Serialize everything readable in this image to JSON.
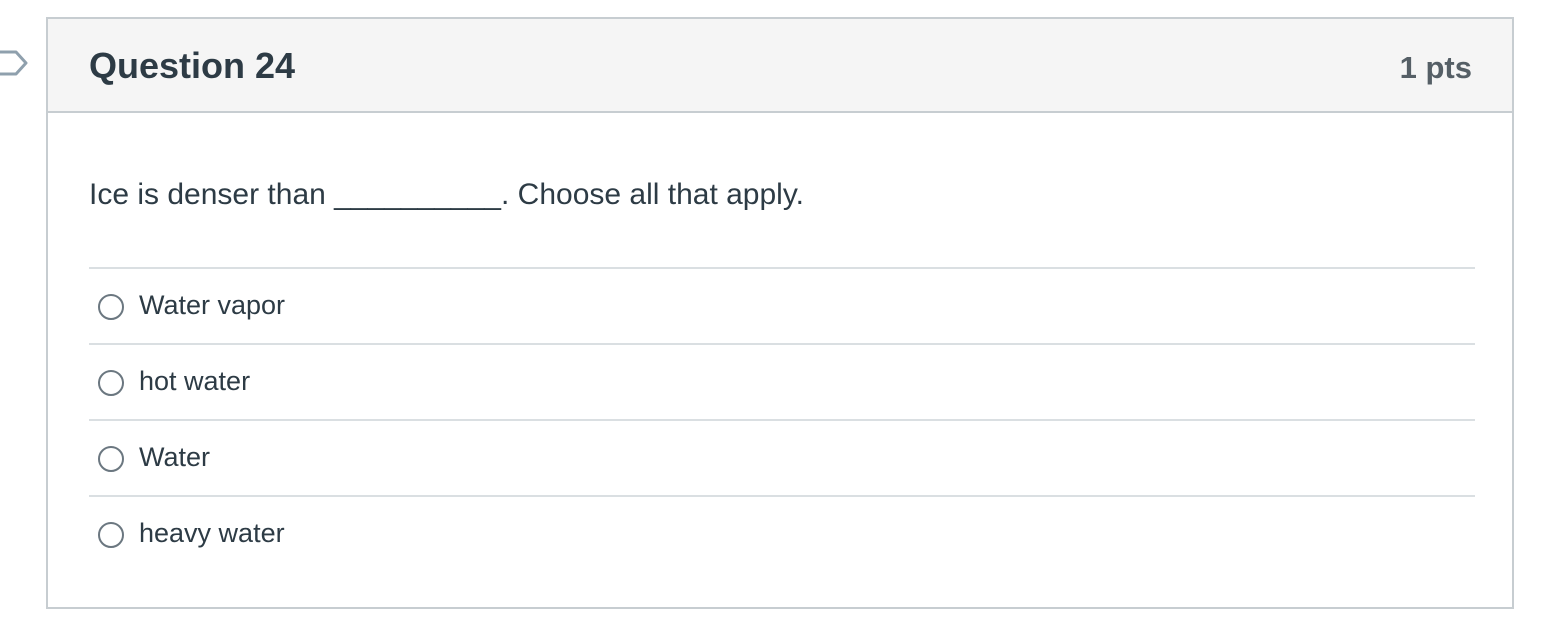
{
  "question": {
    "title": "Question 24",
    "points": "1 pts",
    "text": "Ice is denser than __________. Choose all that apply.",
    "flag_icon": "bookmark-flag-icon",
    "answers": [
      {
        "label": "Water vapor",
        "selected": false
      },
      {
        "label": "hot water",
        "selected": false
      },
      {
        "label": "Water",
        "selected": false
      },
      {
        "label": "heavy water",
        "selected": false
      }
    ]
  },
  "colors": {
    "header_bg": "#f5f5f5",
    "border": "#c7cdd1",
    "divider": "#dadfe2",
    "text": "#2d3b45",
    "points_text": "#555f66",
    "radio_border": "#6b7780"
  }
}
